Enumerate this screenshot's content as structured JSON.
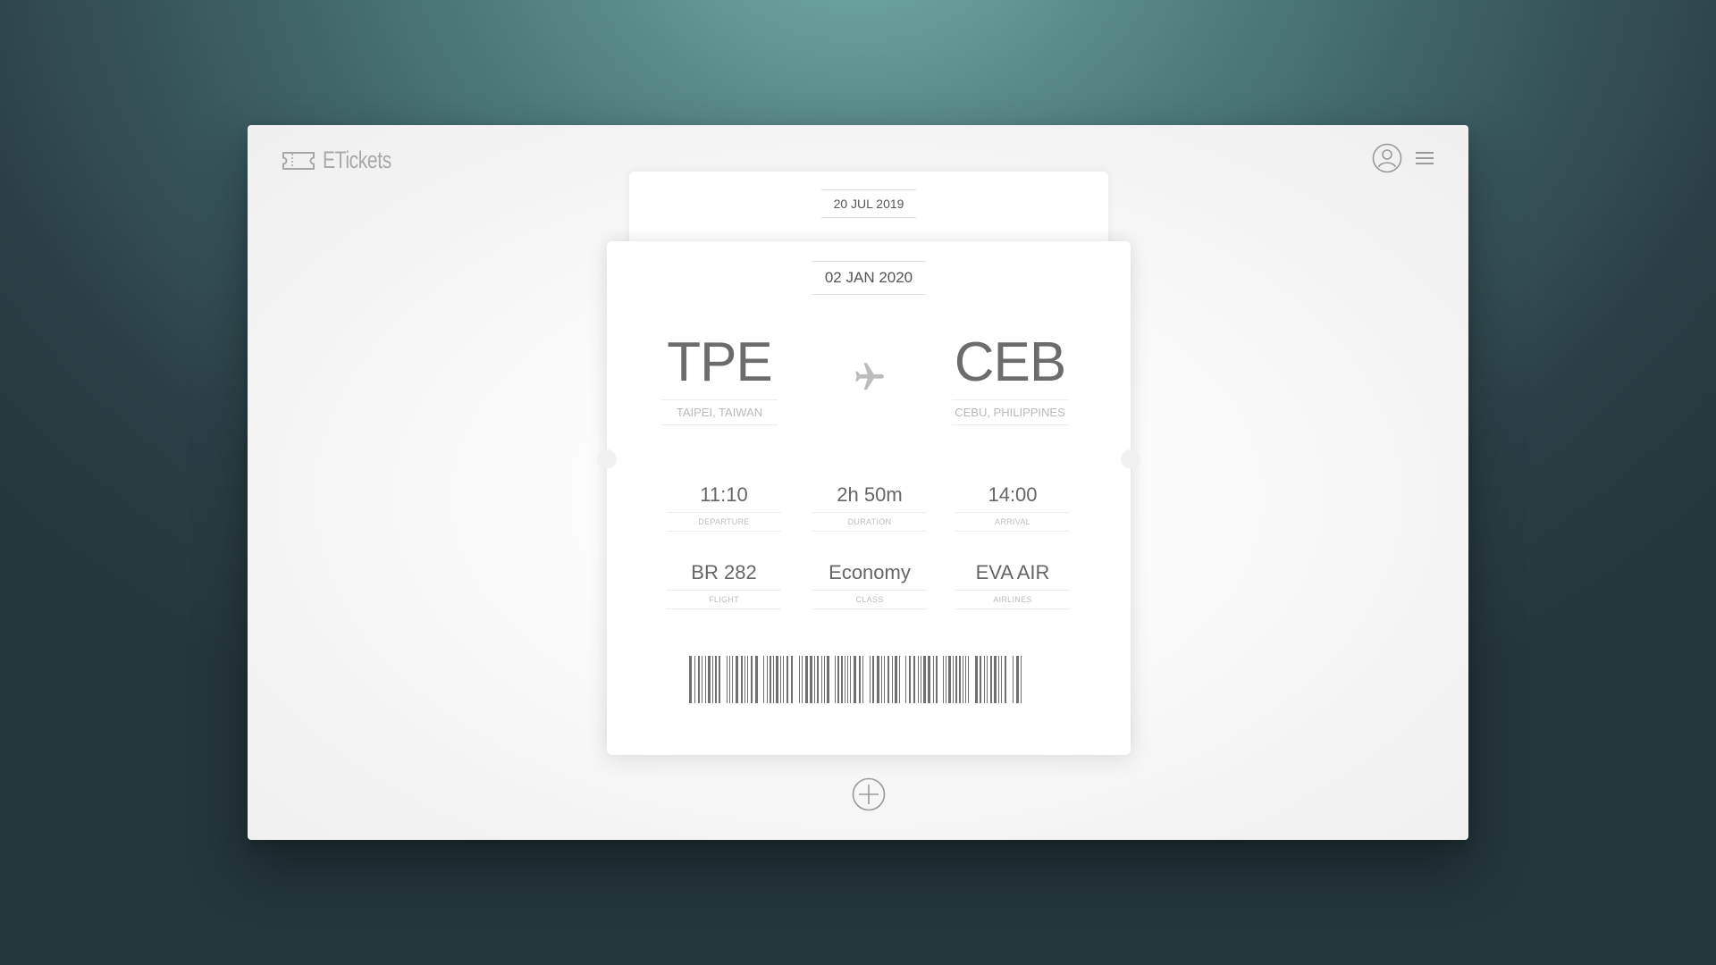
{
  "app": {
    "name": "ETickets"
  },
  "header": {
    "profile_icon": "user-circle-icon",
    "menu_icon": "hamburger-menu-icon"
  },
  "tickets": [
    {
      "date": "20 JUL 2019"
    },
    {
      "date": "02 JAN 2020",
      "from": {
        "code": "TPE",
        "city": "TAIPEI, TAIWAN"
      },
      "to": {
        "code": "CEB",
        "city": "CEBU, PHILIPPINES"
      },
      "departure": {
        "value": "11:10",
        "label": "DEPARTURE"
      },
      "duration": {
        "value": "2h 50m",
        "label": "DURATION"
      },
      "arrival": {
        "value": "14:00",
        "label": "ARRIVAL"
      },
      "flight": {
        "value": "BR 282",
        "label": "FLIGHT"
      },
      "class": {
        "value": "Economy",
        "label": "CLASS"
      },
      "airline": {
        "value": "EVA AIR",
        "label": "AIRLINES"
      }
    }
  ],
  "actions": {
    "add_icon": "plus-circle-icon"
  },
  "colors": {
    "accent_text": "#6c6c6c",
    "muted_text": "#b9b9b9",
    "icon": "#9a9a9a"
  }
}
